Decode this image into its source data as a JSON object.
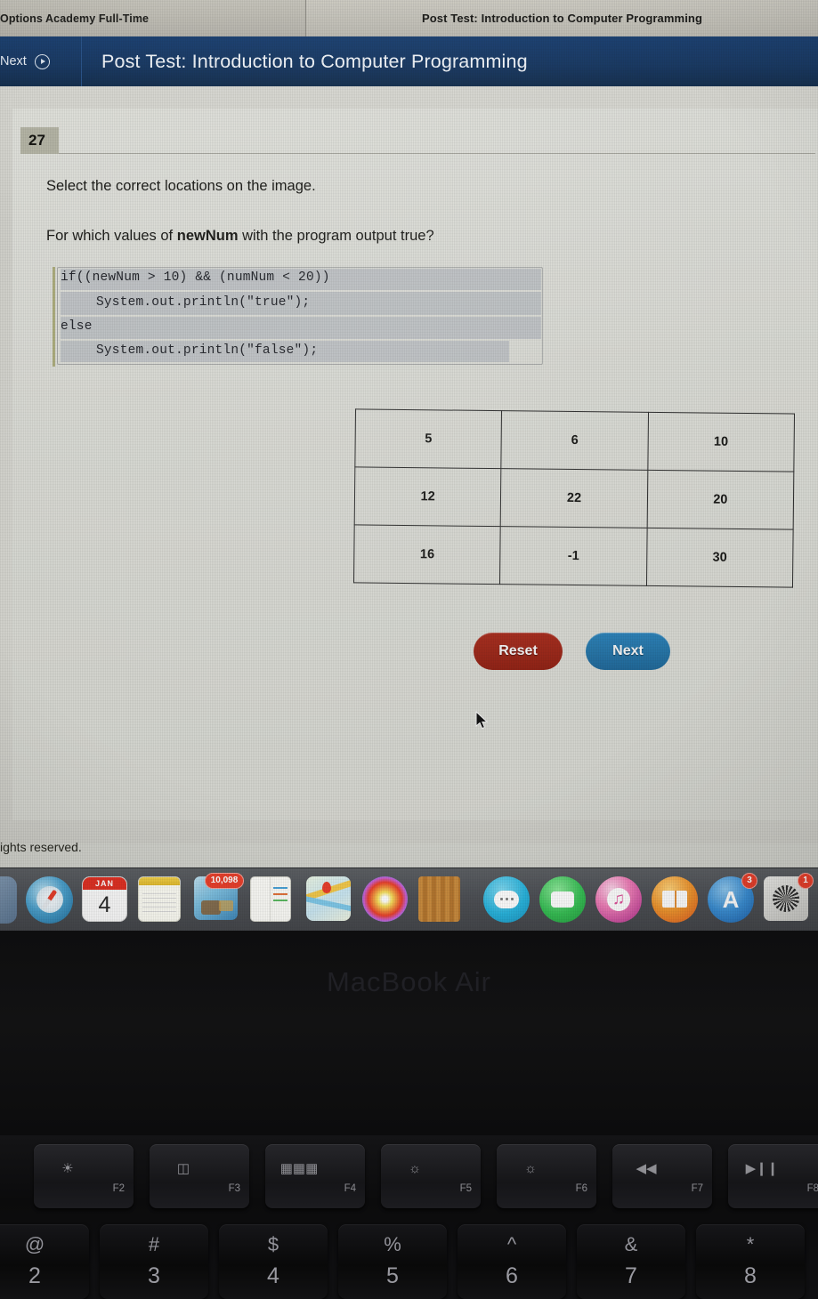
{
  "browser": {
    "tabs": [
      {
        "label": "Options Academy Full-Time",
        "active": false
      },
      {
        "label": "Post Test: Introduction to Computer Programming",
        "active": true
      }
    ]
  },
  "appbar": {
    "next_label": "Next",
    "next_icon": "arrow-circle-right-icon",
    "title": "Post Test: Introduction to Computer Programming",
    "background_color": "#1a3a64"
  },
  "question": {
    "number": "27",
    "instruction": "Select the correct locations on the image.",
    "prompt_prefix": "For which values of ",
    "prompt_bold": "newNum",
    "prompt_suffix": " with the program output true?",
    "code": {
      "line1": "if((newNum > 10) && (numNum < 20))",
      "line2": "System.out.println(\"true\");",
      "line3": "else",
      "line4": "System.out.println(\"false\");"
    },
    "table": {
      "rows": [
        [
          "5",
          "6",
          "10"
        ],
        [
          "12",
          "22",
          "20"
        ],
        [
          "16",
          "-1",
          "30"
        ]
      ]
    }
  },
  "buttons": {
    "reset": {
      "label": "Reset",
      "color": "#8d2013"
    },
    "next": {
      "label": "Next",
      "color": "#1f6695"
    }
  },
  "footer": {
    "text": "ights reserved."
  },
  "dock": {
    "items": [
      {
        "name": "finder-icon",
        "badge": ""
      },
      {
        "name": "safari-icon",
        "badge": ""
      },
      {
        "name": "calendar-icon",
        "month": "JAN",
        "day": "4",
        "badge": ""
      },
      {
        "name": "notes-icon",
        "badge": ""
      },
      {
        "name": "photos-library-icon",
        "badge": "10,098"
      },
      {
        "name": "contacts-icon",
        "badge": ""
      },
      {
        "name": "maps-icon",
        "badge": ""
      },
      {
        "name": "photos-icon",
        "badge": ""
      },
      {
        "name": "ibooks-shelf-icon",
        "badge": ""
      },
      {
        "name": "messages-icon",
        "badge": ""
      },
      {
        "name": "facetime-icon",
        "badge": ""
      },
      {
        "name": "itunes-icon",
        "badge": ""
      },
      {
        "name": "books-icon",
        "badge": ""
      },
      {
        "name": "app-store-icon",
        "badge": "3"
      },
      {
        "name": "system-preferences-icon",
        "badge": "1"
      },
      {
        "name": "chrome-icon",
        "badge": ""
      },
      {
        "name": "opera-icon",
        "badge": ""
      }
    ]
  },
  "laptop": {
    "brand": "MacBook Air",
    "function_keys": [
      {
        "label": "F2",
        "glyph": "brightness-up-icon"
      },
      {
        "label": "F3",
        "glyph": "mission-control-icon"
      },
      {
        "label": "F4",
        "glyph": "launchpad-icon"
      },
      {
        "label": "F5",
        "glyph": "keyboard-backlight-down-icon"
      },
      {
        "label": "F6",
        "glyph": "keyboard-backlight-up-icon"
      },
      {
        "label": "F7",
        "glyph": "rewind-icon"
      },
      {
        "label": "F8",
        "glyph": "play-pause-icon"
      }
    ],
    "number_keys": [
      {
        "symbol": "@",
        "digit": "2"
      },
      {
        "symbol": "#",
        "digit": "3"
      },
      {
        "symbol": "$",
        "digit": "4"
      },
      {
        "symbol": "%",
        "digit": "5"
      },
      {
        "symbol": "^",
        "digit": "6"
      },
      {
        "symbol": "&",
        "digit": "7"
      },
      {
        "symbol": "*",
        "digit": "8"
      }
    ]
  }
}
